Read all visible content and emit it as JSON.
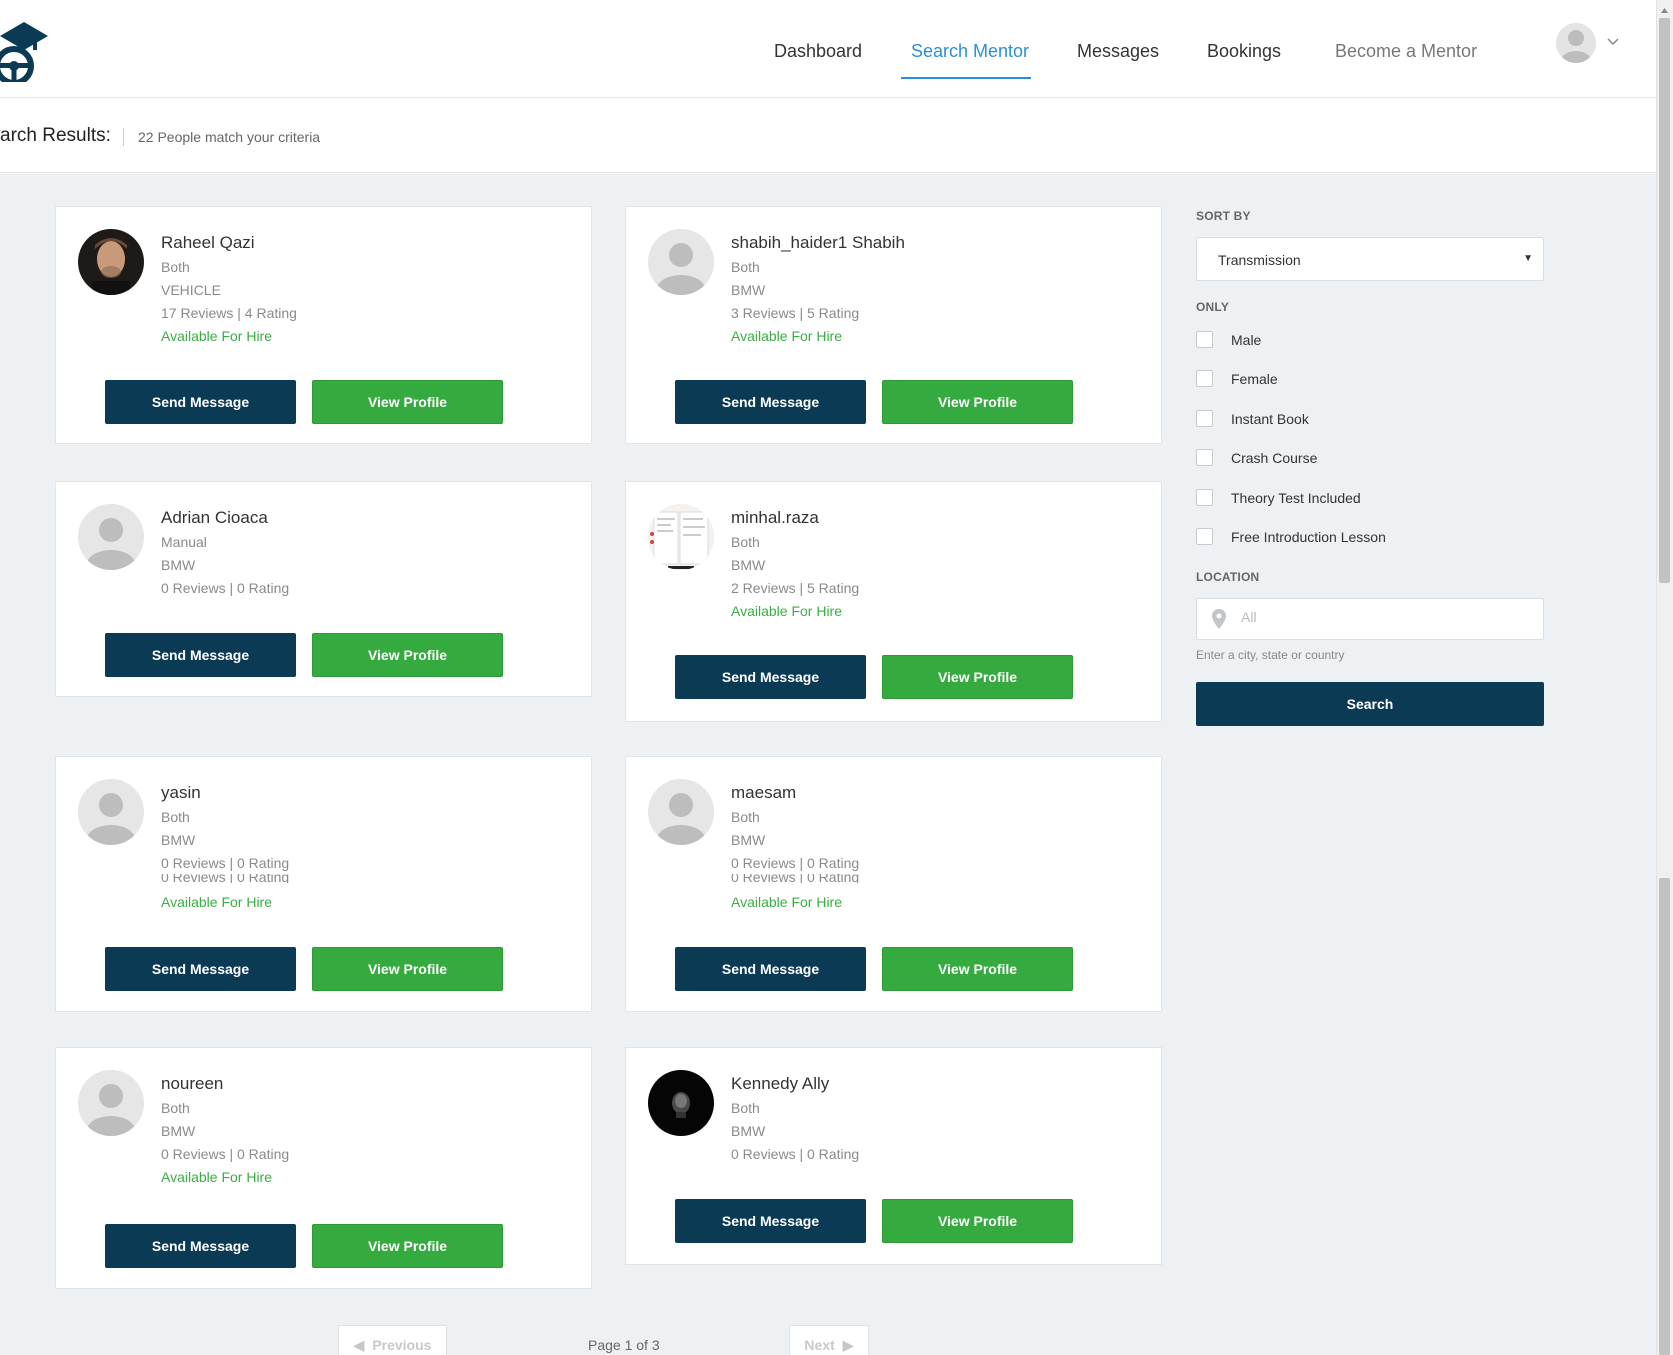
{
  "header": {
    "nav": [
      {
        "label": "Dashboard",
        "state": "normal"
      },
      {
        "label": "Search Mentor",
        "state": "active"
      },
      {
        "label": "Messages",
        "state": "normal"
      },
      {
        "label": "Bookings",
        "state": "normal"
      },
      {
        "label": "Become a Mentor",
        "state": "muted"
      }
    ],
    "user_menu": {
      "icon": "user-avatar-icon",
      "chevron": "chevron-down-icon"
    }
  },
  "results": {
    "title": "arch Results:",
    "count_text": "22 People match your criteria"
  },
  "mentors": [
    {
      "name": "Raheel Qazi",
      "transmission": "Both",
      "vehicle": "VEHICLE",
      "stats": "17 Reviews | 4 Rating",
      "availability": "Available For Hire",
      "avatar": "photo",
      "send_label": "Send Message",
      "view_label": "View Profile"
    },
    {
      "name": "shabih_haider1 Shabih",
      "transmission": "Both",
      "vehicle": "BMW",
      "stats": "3 Reviews | 5 Rating",
      "availability": "Available For Hire",
      "avatar": "placeholder",
      "send_label": "Send Message",
      "view_label": "View Profile"
    },
    {
      "name": "Adrian Cioaca",
      "transmission": "Manual",
      "vehicle": "BMW",
      "stats": "0 Reviews | 0 Rating",
      "availability": "",
      "avatar": "placeholder",
      "send_label": "Send Message",
      "view_label": "View Profile"
    },
    {
      "name": "minhal.raza",
      "transmission": "Both",
      "vehicle": "BMW",
      "stats": "2 Reviews | 5 Rating",
      "availability": "Available For Hire",
      "avatar": "screenshot",
      "send_label": "Send Message",
      "view_label": "View Profile"
    },
    {
      "name": "yasin",
      "transmission": "Both",
      "vehicle": "BMW",
      "stats": "0 Reviews | 0 Rating",
      "stats_ghost": "0 Reviews | 0 Rating",
      "availability": "Available For Hire",
      "avatar": "placeholder",
      "send_label": "Send Message",
      "view_label": "View Profile"
    },
    {
      "name": "maesam",
      "transmission": "Both",
      "vehicle": "BMW",
      "stats": "0 Reviews | 0 Rating",
      "stats_ghost": "0 Reviews | 0 Rating",
      "availability": "Available For Hire",
      "avatar": "placeholder",
      "send_label": "Send Message",
      "view_label": "View Profile"
    },
    {
      "name": "noureen",
      "transmission": "Both",
      "vehicle": "BMW",
      "stats": "0 Reviews | 0 Rating",
      "availability": "Available For Hire",
      "avatar": "placeholder",
      "send_label": "Send Message",
      "view_label": "View Profile"
    },
    {
      "name": "Kennedy Ally",
      "transmission": "Both",
      "vehicle": "BMW",
      "stats": "0 Reviews | 0 Rating",
      "availability": "",
      "avatar": "dark-photo",
      "send_label": "Send Message",
      "view_label": "View Profile"
    }
  ],
  "filters": {
    "sort_label": "SORT BY",
    "sort_value": "Transmission",
    "only_label": "ONLY",
    "options": [
      {
        "label": "Male",
        "checked": false
      },
      {
        "label": "Female",
        "checked": false
      },
      {
        "label": "Instant Book",
        "checked": false
      },
      {
        "label": "Crash Course",
        "checked": false
      },
      {
        "label": "Theory Test Included",
        "checked": false
      },
      {
        "label": "Free Introduction Lesson",
        "checked": false
      }
    ],
    "location_label": "LOCATION",
    "location_placeholder": "All",
    "location_value": "",
    "location_help": "Enter a city, state or country",
    "search_label": "Search"
  },
  "pagination": {
    "previous_label": "Previous",
    "next_label": "Next",
    "page_info": "Page 1 of 3"
  },
  "colors": {
    "primary_dark": "#0b3a55",
    "accent_green": "#35ab3f",
    "nav_active": "#2a8fd6",
    "available": "#3aad43",
    "background": "#eef1f4"
  }
}
